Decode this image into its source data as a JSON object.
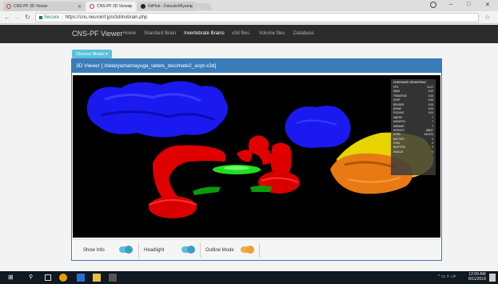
{
  "browser": {
    "tabs": [
      {
        "label": "CNS-PF 3D Viewer",
        "active": false
      },
      {
        "label": "CNS-PF 3D Viewer",
        "active": true
      },
      {
        "label": "GitHub - DaisukeMiyamo",
        "active": false
      }
    ],
    "secure_label": "Secure",
    "url": "https://cns.neuroinf.jp/x3d/invbrain.php"
  },
  "navbar": {
    "brand": "CNS-PF Viewer",
    "links": [
      "Home",
      "Standard Brain",
      "Invertebrate Brains",
      "x3d files",
      "Volume files",
      "Database"
    ],
    "active_index": 2
  },
  "choose_model_label": "Choose Model ▾",
  "viewer": {
    "title": "3D Viewer [ /data/yamamayuga_labels_decimate2_aopt.x3d]"
  },
  "info_panel": {
    "header": "HARDWARE-RENDERING",
    "rows": [
      [
        "FPS",
        "10.07"
      ],
      [
        "ANIM",
        "0.00"
      ],
      [
        "TRAVERSE",
        "0.00"
      ],
      [
        "SORT",
        "0.00"
      ],
      [
        "RENDER",
        "0.00"
      ],
      [
        "DRAW",
        "0.00"
      ],
      [
        "PICKING",
        "0.00"
      ],
      [
        "#MESH",
        "7"
      ],
      [
        "#SHAPES",
        "7"
      ],
      [
        "#DRAWS",
        "7"
      ],
      [
        "#POINTS",
        "88467"
      ],
      [
        "#TRIS",
        "163,974"
      ],
      [
        "BATTERY",
        "0"
      ],
      [
        "PIXEL",
        "0"
      ],
      [
        "BUFFERS",
        "0"
      ],
      [
        "INVALID",
        "0"
      ]
    ]
  },
  "controls": {
    "show_info": "Show Info",
    "headlight": "Headlight",
    "outline_mode": "Outline Mode"
  },
  "taskbar": {
    "time": "12:09 AM",
    "date": "8/11/2018"
  },
  "colors": {
    "navbar": "#2c2c2c",
    "panel_header": "#3a7cb8",
    "choose_button": "#5bc0de",
    "toggle_blue": "#5bc0de",
    "toggle_orange": "#f0ad4e"
  }
}
